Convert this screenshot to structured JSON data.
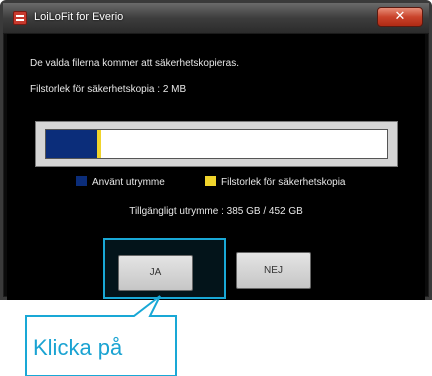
{
  "window": {
    "title": "LoiLoFit for Everio",
    "close_label": "✕"
  },
  "dialog": {
    "message": "De valda filerna kommer att säkerhetskopieras.",
    "file_size": "Filstorlek för säkerhetskopia : 2 MB",
    "usage": {
      "used_fraction": 0.15,
      "file_fraction": 0.01
    },
    "legend": {
      "used_label": "Använt utrymme",
      "file_label": "Filstorlek för säkerhetskopia"
    },
    "available": "Tillgängligt utrymme : 385 GB / 452 GB"
  },
  "buttons": {
    "yes": "JA",
    "no": "NEJ"
  },
  "callout": {
    "text": "Klicka på"
  },
  "colors": {
    "used": "#0b2d7a",
    "file": "#f0d42c",
    "accent": "#19a8d6"
  }
}
